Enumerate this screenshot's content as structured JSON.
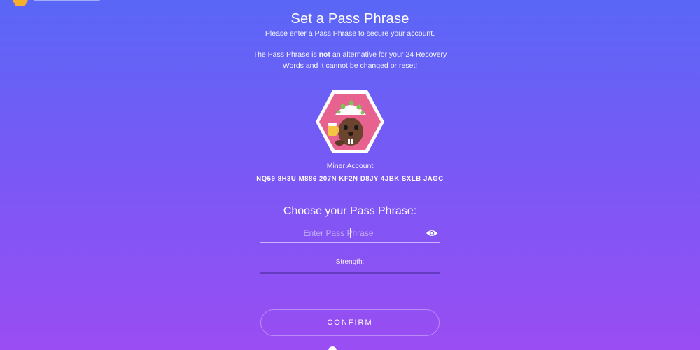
{
  "app": {
    "logo_icon": "nimiq-hexagon-logo-icon",
    "brand_color": "#f6ae2d"
  },
  "header": {
    "title": "Set a Pass Phrase",
    "subtitle": "Please enter a Pass Phrase to secure your account."
  },
  "warning": {
    "before": "The Pass Phrase is ",
    "emphasis": "not",
    "after": " an alternative for your 24 Recovery Words and it cannot be changed or reset!"
  },
  "account": {
    "avatar_icon": "miner-account-avatar-icon",
    "label": "Miner Account",
    "address": "NQ59 8H3U M886 207N KF2N D8JY 4JBK SXLB JAGC"
  },
  "passphrase": {
    "label": "Choose your Pass Phrase:",
    "placeholder": "Enter Pass Phrase",
    "value": "",
    "toggle_icon": "eye-icon"
  },
  "strength": {
    "label": "Strength:",
    "level": 0
  },
  "actions": {
    "confirm_label": "CONFIRM"
  },
  "colors": {
    "gradient_top": "#5a67f6",
    "gradient_bottom": "#9a4df2",
    "avatar_background": "#e8628f"
  }
}
